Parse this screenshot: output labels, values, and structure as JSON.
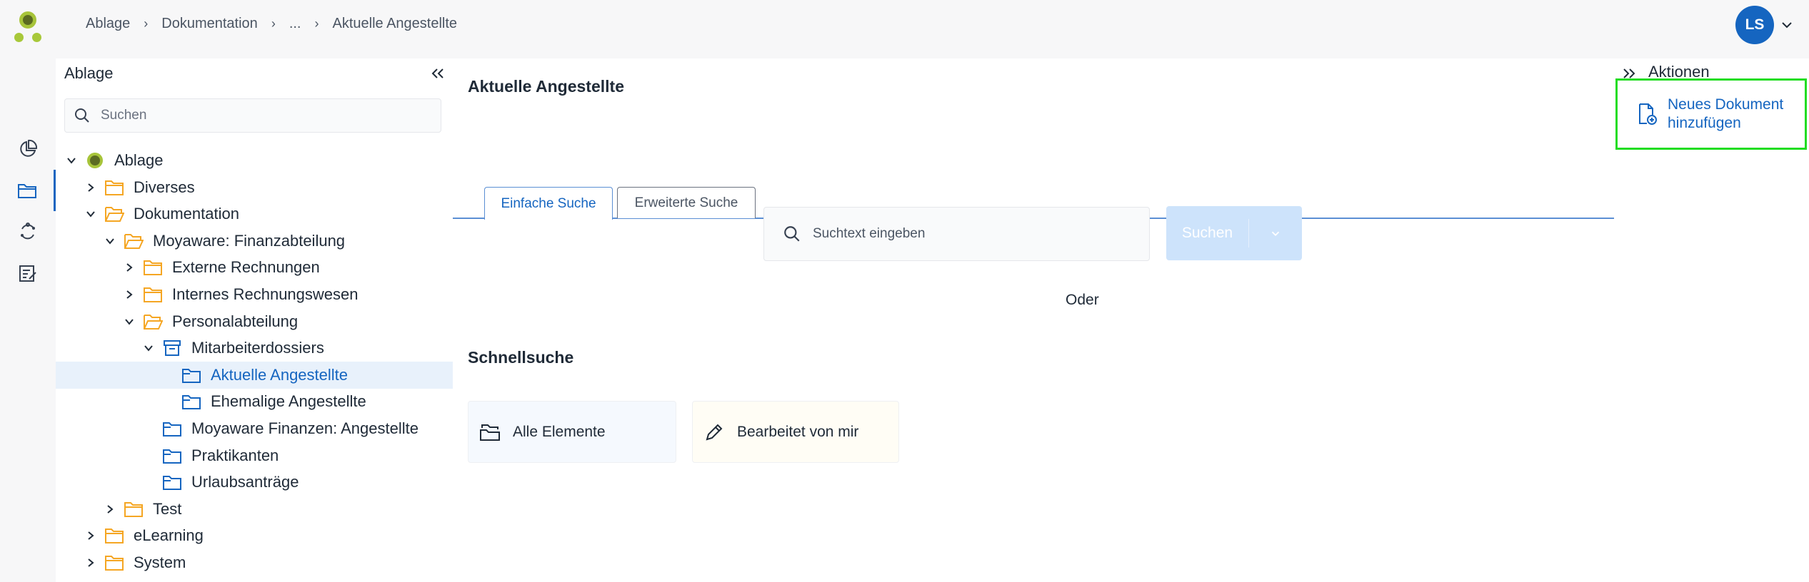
{
  "breadcrumb": {
    "items": [
      "Ablage",
      "Dokumentation",
      "...",
      "Aktuelle Angestellte"
    ]
  },
  "user": {
    "initials": "LS"
  },
  "colors": {
    "accent": "#1565c0",
    "folder": "#f5a623",
    "highlight": "#22dd22",
    "logo": "#a8c83a"
  },
  "rail": {
    "icons": [
      "pie-chart-icon",
      "folder-icon",
      "sync-icon",
      "task-list-icon"
    ]
  },
  "tree_panel": {
    "title": "Ablage",
    "search_placeholder": "Suchen",
    "nodes": [
      {
        "label": "Ablage",
        "icon": "ablage-logo-icon"
      },
      {
        "label": "Diverses",
        "icon": "folder-icon"
      },
      {
        "label": "Dokumentation",
        "icon": "folder-open-icon"
      },
      {
        "label": "Moyaware: Finanzabteilung",
        "icon": "folder-open-icon"
      },
      {
        "label": "Externe Rechnungen",
        "icon": "folder-icon"
      },
      {
        "label": "Internes Rechnungswesen",
        "icon": "folder-icon"
      },
      {
        "label": "Personalabteilung",
        "icon": "folder-open-icon"
      },
      {
        "label": "Mitarbeiterdossiers",
        "icon": "archive-icon"
      },
      {
        "label": "Aktuelle Angestellte",
        "icon": "search-folder-icon"
      },
      {
        "label": "Ehemalige Angestellte",
        "icon": "search-folder-icon"
      },
      {
        "label": "Moyaware Finanzen: Angestellte",
        "icon": "search-folder-icon"
      },
      {
        "label": "Praktikanten",
        "icon": "search-folder-icon"
      },
      {
        "label": "Urlaubsanträge",
        "icon": "search-folder-icon"
      },
      {
        "label": "Test",
        "icon": "folder-icon"
      },
      {
        "label": "eLearning",
        "icon": "folder-icon"
      },
      {
        "label": "System",
        "icon": "folder-icon"
      }
    ]
  },
  "main": {
    "title": "Aktuelle Angestellte",
    "tabs": [
      {
        "label": "Einfache Suche"
      },
      {
        "label": "Erweiterte Suche"
      }
    ],
    "search_placeholder": "Suchtext eingeben",
    "search_button": "Suchen",
    "or_label": "Oder",
    "quick_title": "Schnellsuche",
    "quick_cards": [
      {
        "label": "Alle Elemente"
      },
      {
        "label": "Bearbeitet von mir"
      }
    ]
  },
  "actions": {
    "title": "Aktionen",
    "items": [
      {
        "label": "Neues Dokument hinzufügen"
      }
    ]
  }
}
